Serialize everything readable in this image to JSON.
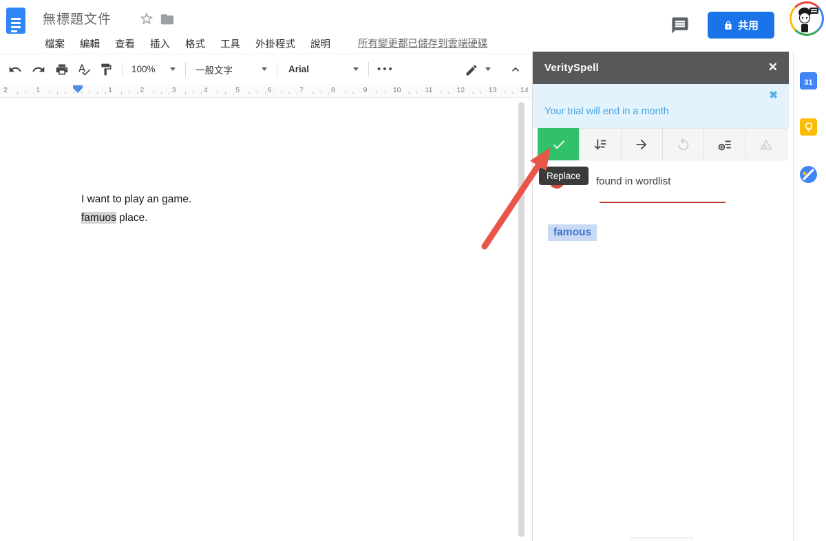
{
  "colors": {
    "accent-blue": "#1a73e8",
    "logo-blue": "#3086f6",
    "green": "#31c16b",
    "sidebar-header-bg": "#57585a",
    "trial-bg": "#e3f3fd",
    "trial-text": "#45a3e0",
    "arrow-red": "#e8564a",
    "underline-red": "#b9453a",
    "suggestion-text": "#4273cf",
    "suggestion-bg": "#c9daf5",
    "tooltip-bg": "#3b3b3b",
    "selection-gray": "#d4d4d4"
  },
  "header": {
    "doc_title": "無標題文件",
    "menu_items": [
      "檔案",
      "編輯",
      "查看",
      "插入",
      "格式",
      "工具",
      "外掛程式",
      "說明"
    ],
    "save_status": "所有變更都已儲存到雲端硬碟",
    "share_label": "共用"
  },
  "toolbar": {
    "zoom_value": "100%",
    "style_value": "一般文字",
    "font_value": "Arial",
    "more_icon": "•••",
    "icons": [
      "undo-icon",
      "redo-icon",
      "print-icon",
      "spellcheck-icon",
      "paint-format-icon",
      "edit-mode-pencil-icon",
      "collapse-toolbar-icon"
    ]
  },
  "ruler": {
    "labels": [
      "2",
      "1",
      "1",
      "2",
      "3",
      "4",
      "5",
      "6",
      "7",
      "8",
      "9",
      "10",
      "11",
      "12",
      "13",
      "14"
    ]
  },
  "document_text": {
    "line1": "I want to play an game.",
    "line2_word": "famuos",
    "line2_rest": " place."
  },
  "sidebar": {
    "title": "VeritySpell",
    "trial_message": "Your trial will end in a month",
    "tooltip_label": "Replace",
    "result_text": "found in wordlist",
    "suggestion": "famous",
    "dismiss_glyph": "✖",
    "close_glyph": "✕",
    "toolbar_icons": [
      "replace-check-icon",
      "sort-icon",
      "next-word-icon",
      "undo-change-icon",
      "add-to-wordlist-icon",
      "ignore-warning-icon"
    ]
  },
  "companion": {
    "calendar_day": "31"
  }
}
